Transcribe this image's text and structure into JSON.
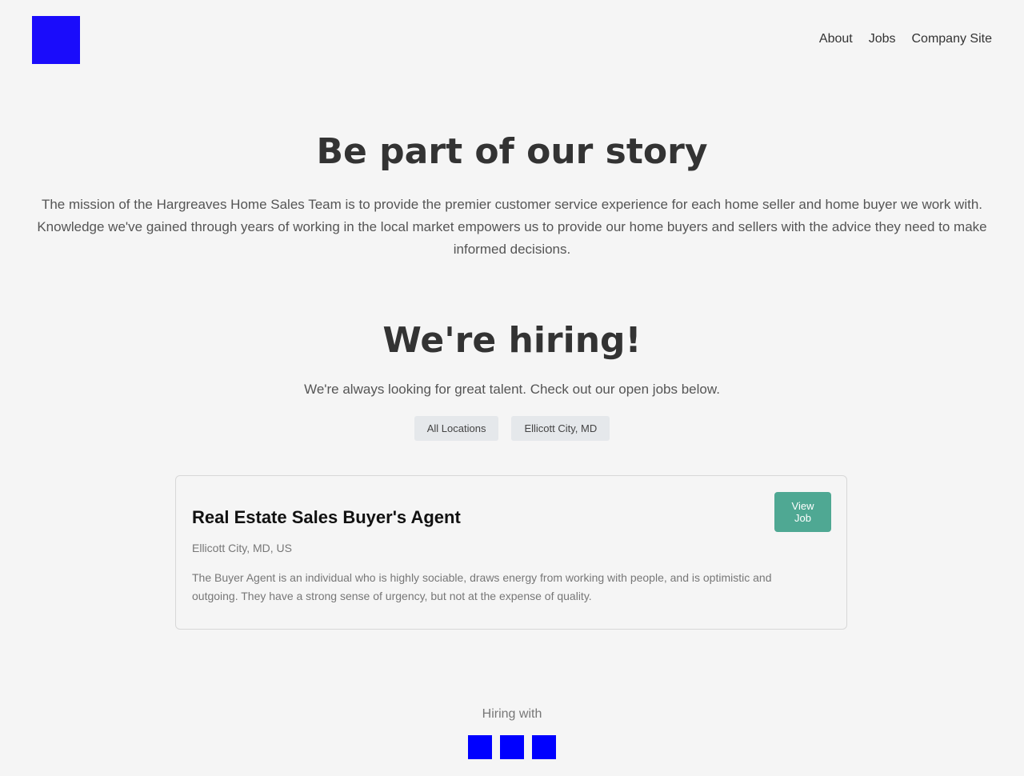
{
  "header": {
    "logo_color": "#1a0cfb",
    "nav": [
      {
        "label": "About"
      },
      {
        "label": "Jobs"
      },
      {
        "label": "Company Site"
      }
    ]
  },
  "story": {
    "title": "Be part of our story",
    "body": "The mission of the Hargreaves Home Sales Team is to provide the premier customer service experience for each home seller and home buyer we work with. Knowledge we've gained through years of working in the local market empowers us to provide our home buyers and sellers with the advice they need to make informed decisions."
  },
  "hiring": {
    "title": "We're hiring!",
    "subtitle": "We're always looking for great talent. Check out our open jobs below.",
    "filters": [
      {
        "label": "All Locations"
      },
      {
        "label": "Ellicott City, MD"
      }
    ]
  },
  "jobs": [
    {
      "title": "Real Estate Sales Buyer's Agent",
      "location": "Ellicott City, MD, US",
      "description": "The Buyer Agent is an individual who is highly sociable, draws energy from working with people, and is optimistic and outgoing. They have a strong sense of urgency, but not at the expense of quality.",
      "button_label": "View Job",
      "button_color": "#4fa893"
    }
  ],
  "footer": {
    "hiring_with": "Hiring with",
    "social_icons": [
      "social-icon-1",
      "social-icon-2",
      "social-icon-3"
    ],
    "social_color": "#0000ff"
  }
}
